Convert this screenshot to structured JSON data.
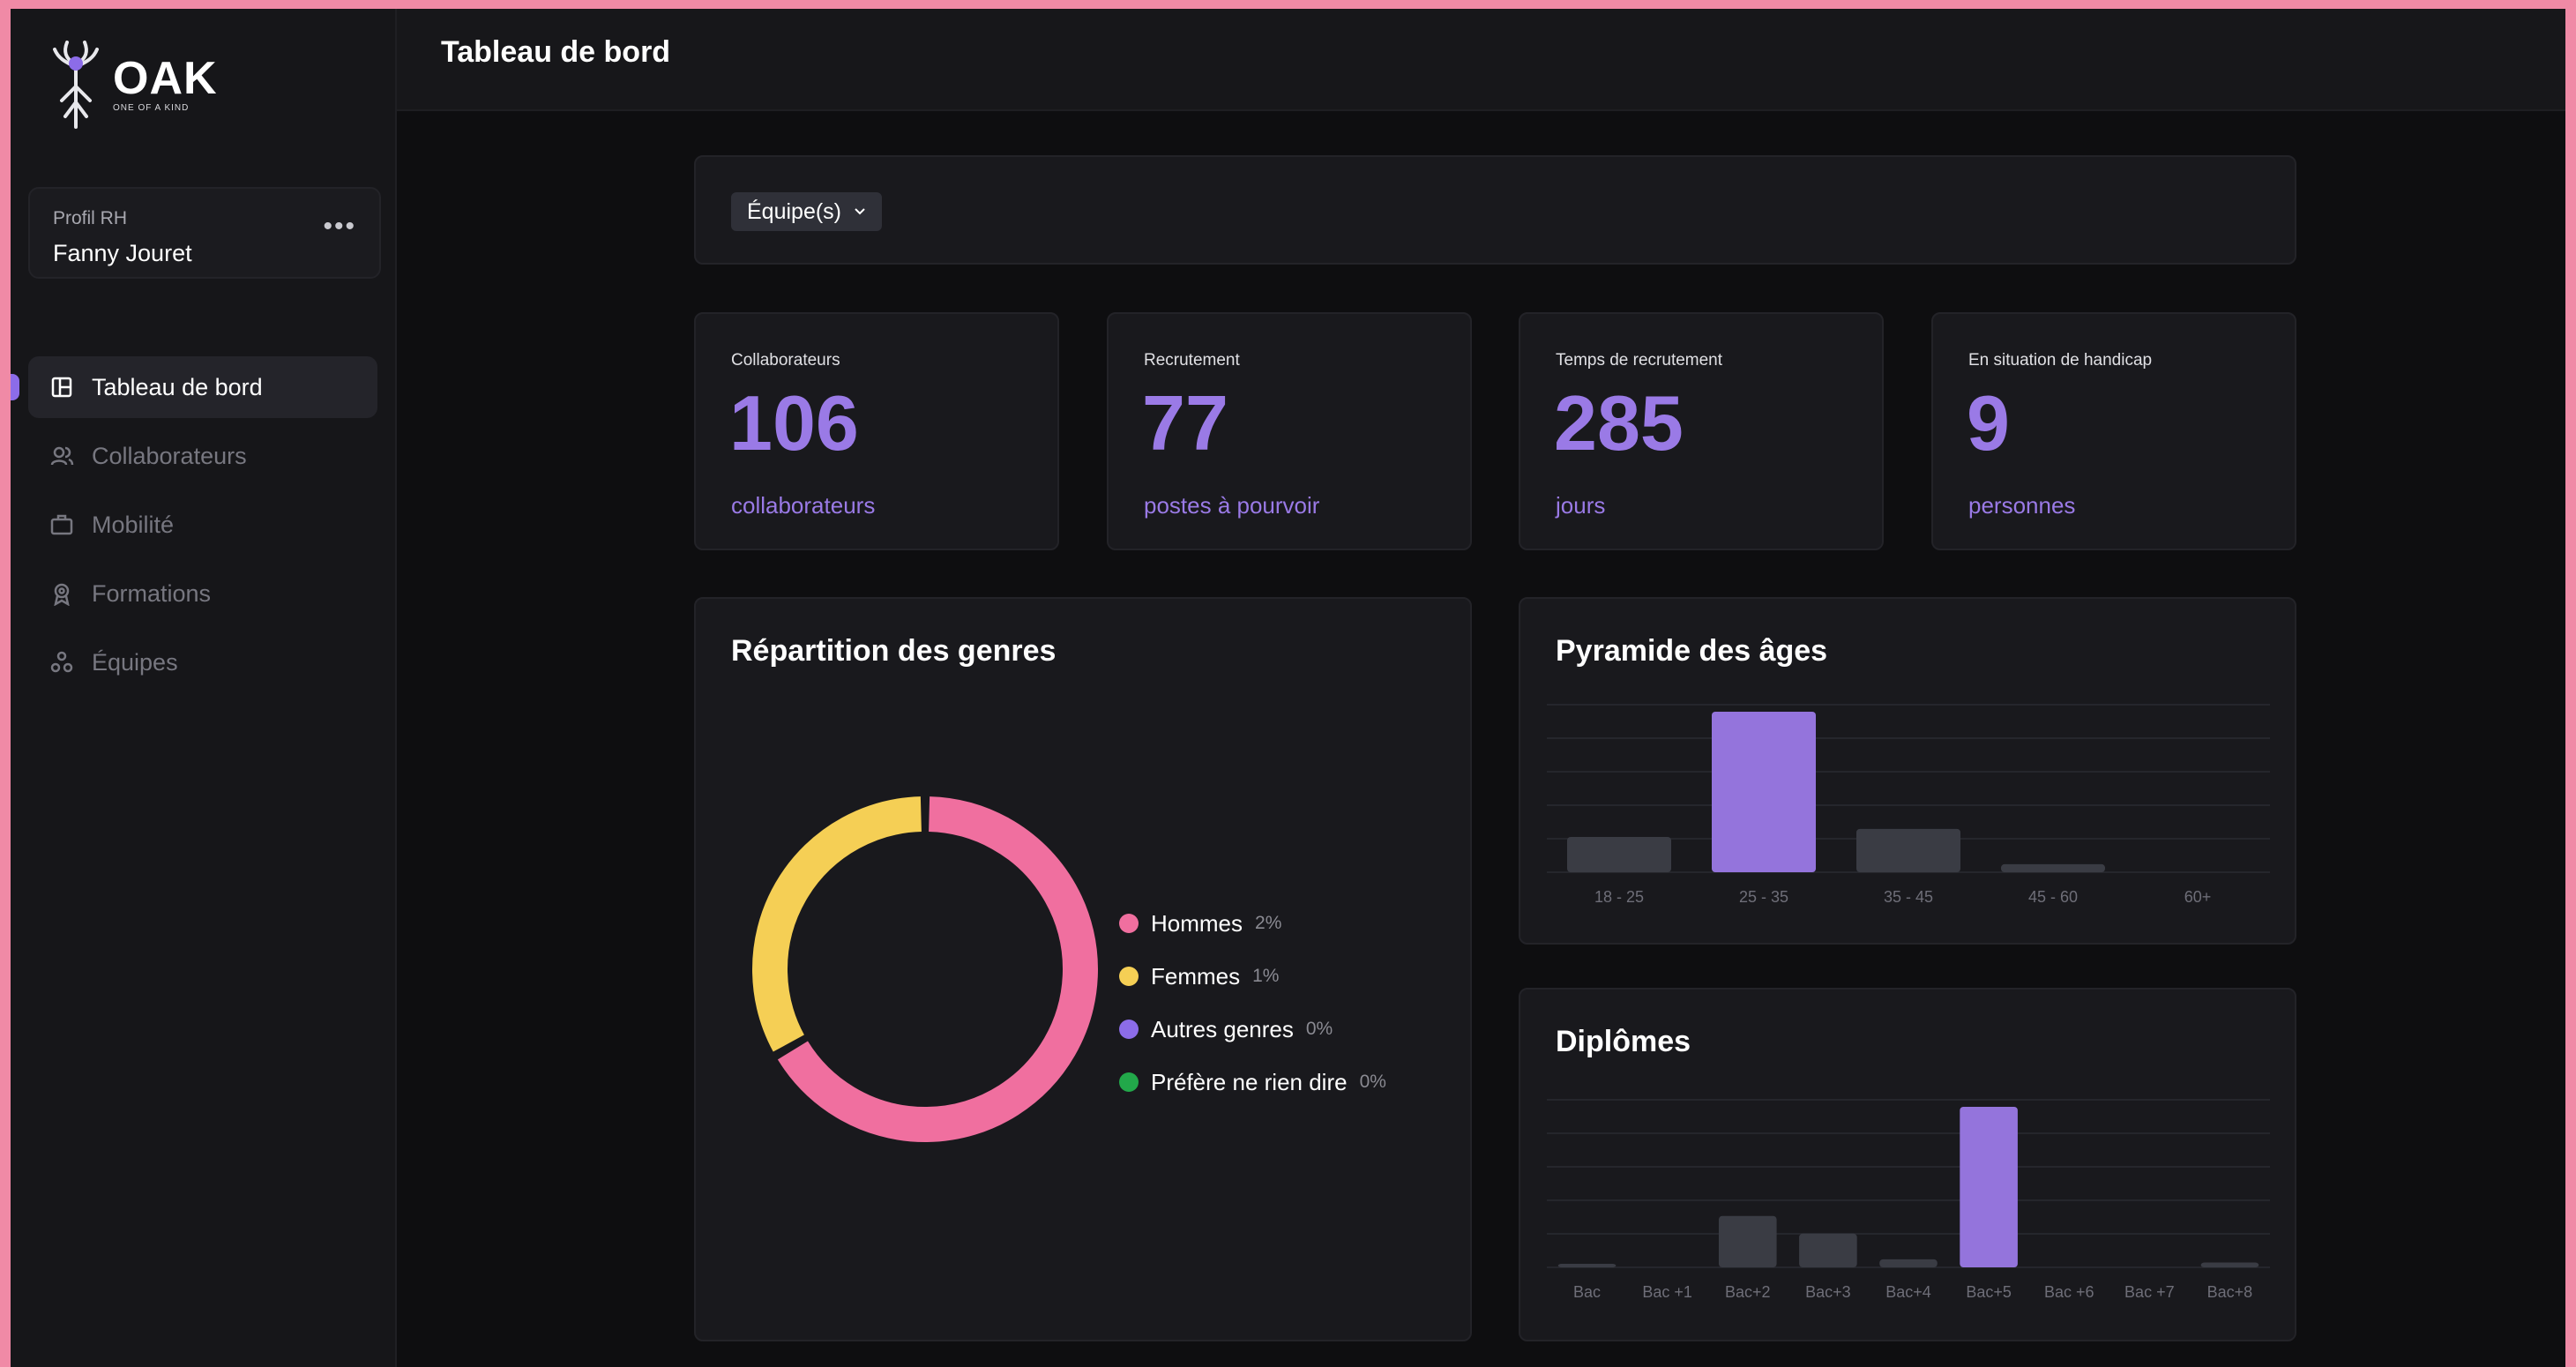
{
  "logo": {
    "name": "OAK",
    "tagline": "ONE OF A KIND"
  },
  "profile": {
    "role": "Profil RH",
    "name": "Fanny Jouret",
    "more": "•••"
  },
  "sidebar": {
    "items": [
      {
        "label": "Tableau de bord",
        "icon": "layout-icon",
        "active": true
      },
      {
        "label": "Collaborateurs",
        "icon": "users-icon",
        "active": false
      },
      {
        "label": "Mobilité",
        "icon": "briefcase-icon",
        "active": false
      },
      {
        "label": "Formations",
        "icon": "award-icon",
        "active": false
      },
      {
        "label": "Équipes",
        "icon": "team-icon",
        "active": false
      }
    ]
  },
  "header": {
    "title": "Tableau de bord"
  },
  "filter": {
    "label": "Équipe(s)"
  },
  "kpis": [
    {
      "label": "Collaborateurs",
      "value": "106",
      "unit": "collaborateurs"
    },
    {
      "label": "Recrutement",
      "value": "77",
      "unit": "postes à pourvoir"
    },
    {
      "label": "Temps de recrutement",
      "value": "285",
      "unit": "jours"
    },
    {
      "label": "En situation de handicap",
      "value": "9",
      "unit": "personnes"
    }
  ],
  "colors": {
    "accent": "#9a7ae6",
    "hommes": "#f06f9f",
    "femmes": "#f5cf55",
    "autres": "#8c6ce8",
    "prefere": "#22a84a",
    "bar_muted": "#3a3c44",
    "bar_highlight": "#9474dc"
  },
  "chart_data": [
    {
      "type": "pie",
      "title": "Répartition des genres",
      "series": [
        {
          "name": "Hommes",
          "label": "2%",
          "value": 2
        },
        {
          "name": "Femmes",
          "label": "1%",
          "value": 1
        },
        {
          "name": "Autres genres",
          "label": "0%",
          "value": 0
        },
        {
          "name": "Préfère ne rien dire",
          "label": "0%",
          "value": 0
        }
      ]
    },
    {
      "type": "bar",
      "title": "Pyramide des âges",
      "categories": [
        "18 - 25",
        "25 - 35",
        "35 - 45",
        "45 - 60",
        "60+"
      ],
      "values": [
        22,
        100,
        27,
        5,
        0
      ],
      "highlight": "25 - 35",
      "grid": true
    },
    {
      "type": "bar",
      "title": "Diplômes",
      "categories": [
        "Bac",
        "Bac +1",
        "Bac+2",
        "Bac+3",
        "Bac+4",
        "Bac+5",
        "Bac +6",
        "Bac +7",
        "Bac+8"
      ],
      "values": [
        2,
        0,
        32,
        21,
        5,
        100,
        0,
        0,
        3
      ],
      "highlight": "Bac+5",
      "grid": true
    }
  ]
}
